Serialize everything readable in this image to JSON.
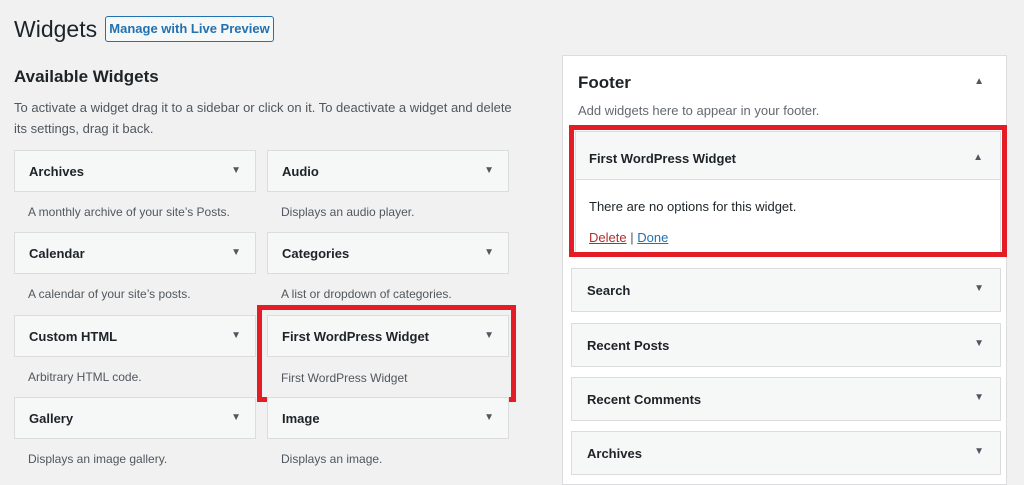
{
  "header": {
    "title": "Widgets",
    "live_preview_button": "Manage with Live Preview"
  },
  "available": {
    "title": "Available Widgets",
    "description": "To activate a widget drag it to a sidebar or click on it. To deactivate a widget and delete its settings, drag it back.",
    "widgets": [
      {
        "name": "Archives",
        "desc": "A monthly archive of your site’s Posts."
      },
      {
        "name": "Audio",
        "desc": "Displays an audio player."
      },
      {
        "name": "Calendar",
        "desc": "A calendar of your site’s posts."
      },
      {
        "name": "Categories",
        "desc": "A list or dropdown of categories."
      },
      {
        "name": "Custom HTML",
        "desc": "Arbitrary HTML code."
      },
      {
        "name": "First WordPress Widget",
        "desc": "First WordPress Widget"
      },
      {
        "name": "Gallery",
        "desc": "Displays an image gallery."
      },
      {
        "name": "Image",
        "desc": "Displays an image."
      }
    ]
  },
  "footer_sidebar": {
    "title": "Footer",
    "description": "Add widgets here to appear in your footer.",
    "open_widget": {
      "title": "First WordPress Widget",
      "message": "There are no options for this widget.",
      "delete_label": "Delete",
      "separator": "|",
      "done_label": "Done"
    },
    "widgets": [
      "Search",
      "Recent Posts",
      "Recent Comments",
      "Archives"
    ]
  },
  "icons": {
    "collapse": "arrow-down-icon",
    "expand": "arrow-up-icon"
  },
  "colors": {
    "highlight": "#e31c25",
    "link": "#2271b1",
    "delete": "#b32d2e"
  }
}
